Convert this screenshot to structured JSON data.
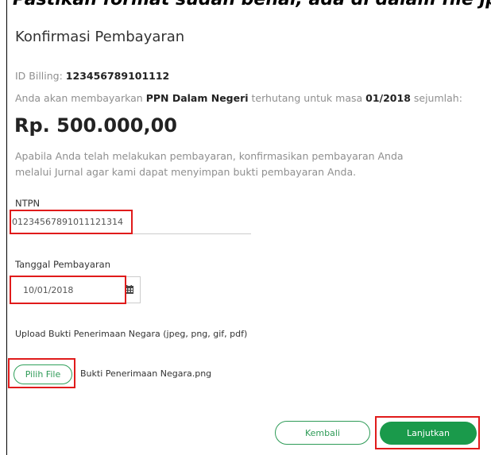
{
  "header_strip": {
    "text": "Pastikan format sudah benar, ada di dalam file jpeg atau png"
  },
  "dialog": {
    "title": "Konfirmasi Pembayaran",
    "billing_label": "ID Billing: ",
    "billing_id": "123456789101112",
    "payment_text_1": "Anda akan membayarkan ",
    "tax_type": "PPN Dalam Negeri",
    "payment_text_2": " terhutang untuk masa ",
    "period": "01/2018",
    "payment_text_3": " sejumlah:",
    "amount": "Rp. 500.000,00",
    "description": "Apabila Anda telah melakukan pembayaran, konfirmasikan pembayaran Anda melalui Jurnal agar kami dapat menyimpan bukti pembayaran Anda."
  },
  "form": {
    "ntpn_label": "NTPN",
    "ntpn_value": "01234567891011121314",
    "date_label": "Tanggal Pembayaran",
    "date_value": "10/01/2018",
    "upload_label": "Upload Bukti Penerimaan Negara (jpeg, png, gif, pdf)",
    "choose_file_label": "Pilih File",
    "file_name": "Bukti Penerimaan Negara.png"
  },
  "actions": {
    "back_label": "Kembali",
    "continue_label": "Lanjutkan"
  },
  "icons": {
    "calendar": "calendar-icon"
  },
  "colors": {
    "accent_green": "#1a9a4b",
    "highlight_red": "#e01b1b"
  }
}
